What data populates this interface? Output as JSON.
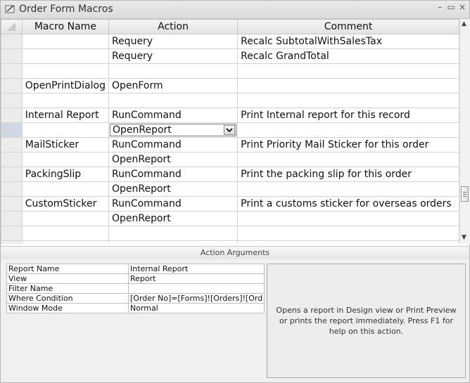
{
  "window": {
    "title": "Order Form Macros",
    "controls": [
      "–",
      "▭",
      "×"
    ]
  },
  "grid": {
    "columns": [
      "Macro Name",
      "Action",
      "Comment"
    ],
    "rows": [
      {
        "name": "",
        "action": "Requery",
        "comment": "Recalc SubtotalWithSalesTax"
      },
      {
        "name": "",
        "action": "Requery",
        "comment": "Recalc GrandTotal"
      },
      {
        "name": "",
        "action": "",
        "comment": ""
      },
      {
        "name": "OpenPrintDialog",
        "action": "OpenForm",
        "comment": ""
      },
      {
        "name": "",
        "action": "",
        "comment": ""
      },
      {
        "name": "Internal Report",
        "action": "RunCommand",
        "comment": "Print Internal report for this record"
      },
      {
        "name": "",
        "action": "OpenReport",
        "comment": ""
      },
      {
        "name": "MailSticker",
        "action": "RunCommand",
        "comment": "Print Priority Mail Sticker for this order"
      },
      {
        "name": "",
        "action": "OpenReport",
        "comment": ""
      },
      {
        "name": "PackingSlip",
        "action": "RunCommand",
        "comment": "Print the packing slip for this order"
      },
      {
        "name": "",
        "action": "OpenReport",
        "comment": ""
      },
      {
        "name": "CustomSticker",
        "action": "RunCommand",
        "comment": "Print a customs sticker for overseas orders"
      },
      {
        "name": "",
        "action": "OpenReport",
        "comment": ""
      },
      {
        "name": "",
        "action": "",
        "comment": ""
      },
      {
        "name": "",
        "action": "",
        "comment": ""
      }
    ],
    "current_row_index": 6
  },
  "action_arguments": {
    "header": "Action Arguments",
    "rows": [
      {
        "label": "Report Name",
        "value": "Internal Report"
      },
      {
        "label": "View",
        "value": "Report"
      },
      {
        "label": "Filter Name",
        "value": ""
      },
      {
        "label": "Where Condition",
        "value": "[Order No]=[Forms]![Orders]![Ord"
      },
      {
        "label": "Window Mode",
        "value": "Normal"
      }
    ],
    "help_text": "Opens a report in Design view or Print Preview or prints the report immediately. Press F1 for help on this action."
  }
}
